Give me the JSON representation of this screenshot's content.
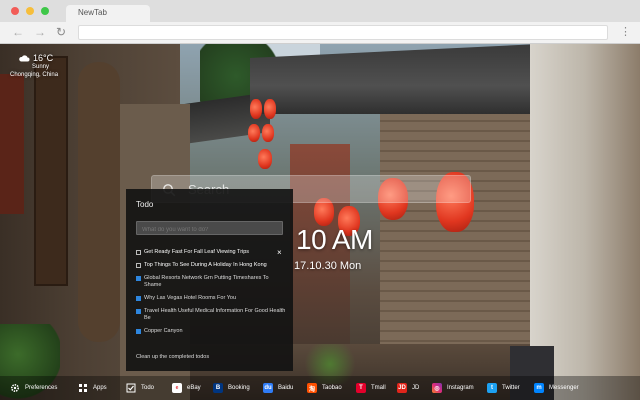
{
  "browser": {
    "tab_title": "NewTab"
  },
  "weather": {
    "temperature": "16°C",
    "condition": "Sunny",
    "location": "Chongqing, China",
    "icon": "cloud-icon"
  },
  "search": {
    "placeholder": "Search"
  },
  "clock": {
    "time": "10 AM",
    "date": "17.10.30 Mon"
  },
  "todo": {
    "title": "Todo",
    "input_placeholder": "What do you want to do?",
    "items": [
      {
        "text": "Get Ready Fast For Fall Leaf Viewing Trips",
        "done": false
      },
      {
        "text": "Top Things To See During A Holiday In Hong Kong",
        "done": false
      },
      {
        "text": "Global Resorts Network Grn Putting Timeshares To Shame",
        "done": true
      },
      {
        "text": "Why Las Vegas Hotel Rooms For You",
        "done": true
      },
      {
        "text": "Travel Health Useful Medical Information For Good Health Be",
        "done": true
      },
      {
        "text": "Copper Canyon",
        "done": true
      }
    ],
    "close_glyph": "×",
    "clear_label": "Clean up the completed todos"
  },
  "bottom_bar": {
    "items": [
      {
        "label": "Preferences",
        "icon": "gear-icon",
        "color": "#ffffff"
      },
      {
        "label": "Apps",
        "icon": "apps-grid-icon",
        "color": "#ffffff"
      },
      {
        "label": "Todo",
        "icon": "checkbox-icon",
        "color": "#ffffff"
      },
      {
        "label": "eBay",
        "icon": "ebay-icon",
        "color": "#ffffff"
      },
      {
        "label": "Booking",
        "icon": "booking-icon",
        "color": "#003580"
      },
      {
        "label": "Baidu",
        "icon": "baidu-icon",
        "color": "#2f7cf6"
      },
      {
        "label": "Taobao",
        "icon": "taobao-icon",
        "color": "#ff5000"
      },
      {
        "label": "Tmall",
        "icon": "tmall-icon",
        "color": "#e4002b"
      },
      {
        "label": "JD",
        "icon": "jd-icon",
        "color": "#e1251b"
      },
      {
        "label": "Instagram",
        "icon": "instagram-icon",
        "color": "#c13584"
      },
      {
        "label": "Twitter",
        "icon": "twitter-icon",
        "color": "#1da1f2"
      },
      {
        "label": "Messenger",
        "icon": "messenger-icon",
        "color": "#0084ff"
      }
    ]
  }
}
